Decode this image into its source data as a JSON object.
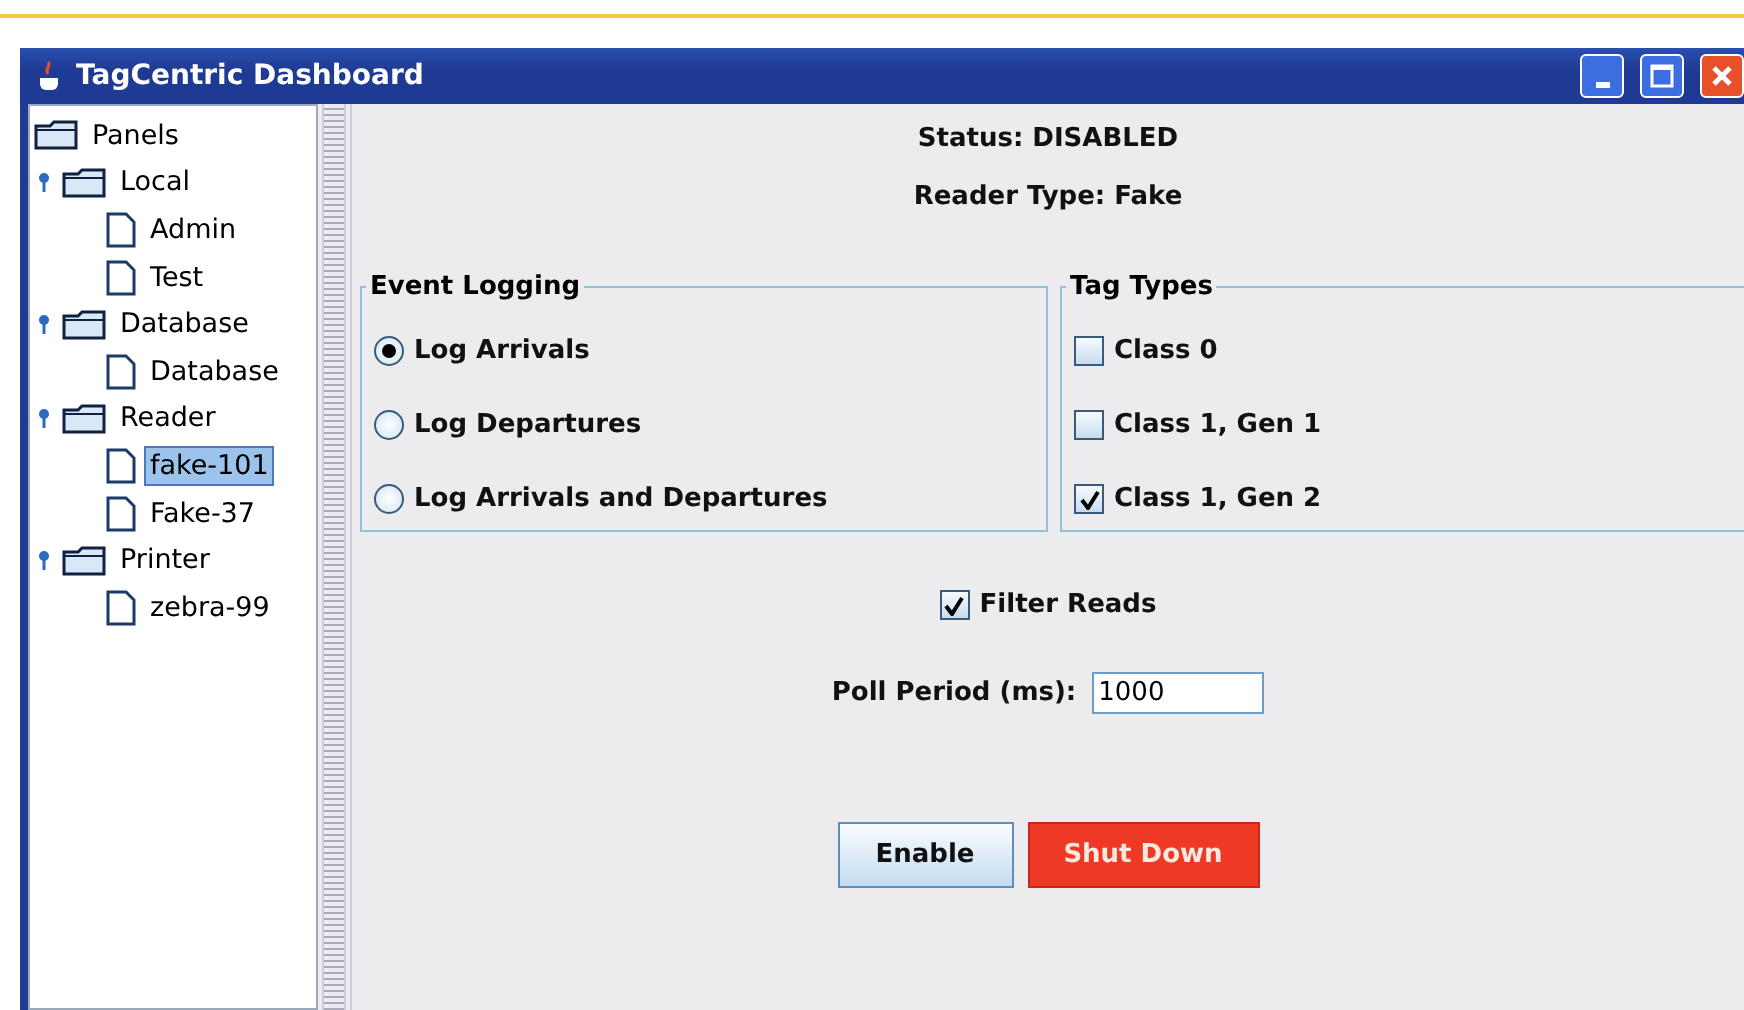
{
  "window": {
    "title": "TagCentric Dashboard"
  },
  "tree": {
    "label": "Panels",
    "children": [
      {
        "label": "Local",
        "expanded": true,
        "selected": false,
        "children": [
          {
            "label": "Admin",
            "selected": false
          },
          {
            "label": "Test",
            "selected": false
          }
        ]
      },
      {
        "label": "Database",
        "expanded": true,
        "selected": false,
        "children": [
          {
            "label": "Database",
            "selected": false
          }
        ]
      },
      {
        "label": "Reader",
        "expanded": true,
        "selected": false,
        "children": [
          {
            "label": "fake-101",
            "selected": true
          },
          {
            "label": "Fake-37",
            "selected": false
          }
        ]
      },
      {
        "label": "Printer",
        "expanded": true,
        "selected": false,
        "children": [
          {
            "label": "zebra-99",
            "selected": false
          }
        ]
      }
    ]
  },
  "status": "Status: DISABLED",
  "reader_type": "Reader Type: Fake",
  "event_logging": {
    "title": "Event Logging",
    "options": [
      {
        "label": "Log Arrivals",
        "selected": true
      },
      {
        "label": "Log Departures",
        "selected": false
      },
      {
        "label": "Log Arrivals and Departures",
        "selected": false
      }
    ]
  },
  "tag_types": {
    "title": "Tag Types",
    "options": [
      {
        "label": "Class 0",
        "checked": false
      },
      {
        "label": "Class 1, Gen 1",
        "checked": false
      },
      {
        "label": "Class 1, Gen 2",
        "checked": true
      }
    ]
  },
  "filter_reads": {
    "label": "Filter Reads",
    "checked": true
  },
  "poll_period": {
    "label": "Poll Period (ms):",
    "value": "1000"
  },
  "buttons": [
    {
      "label": "Enable",
      "kind": "normal"
    },
    {
      "label": "Shut Down",
      "kind": "danger"
    }
  ]
}
